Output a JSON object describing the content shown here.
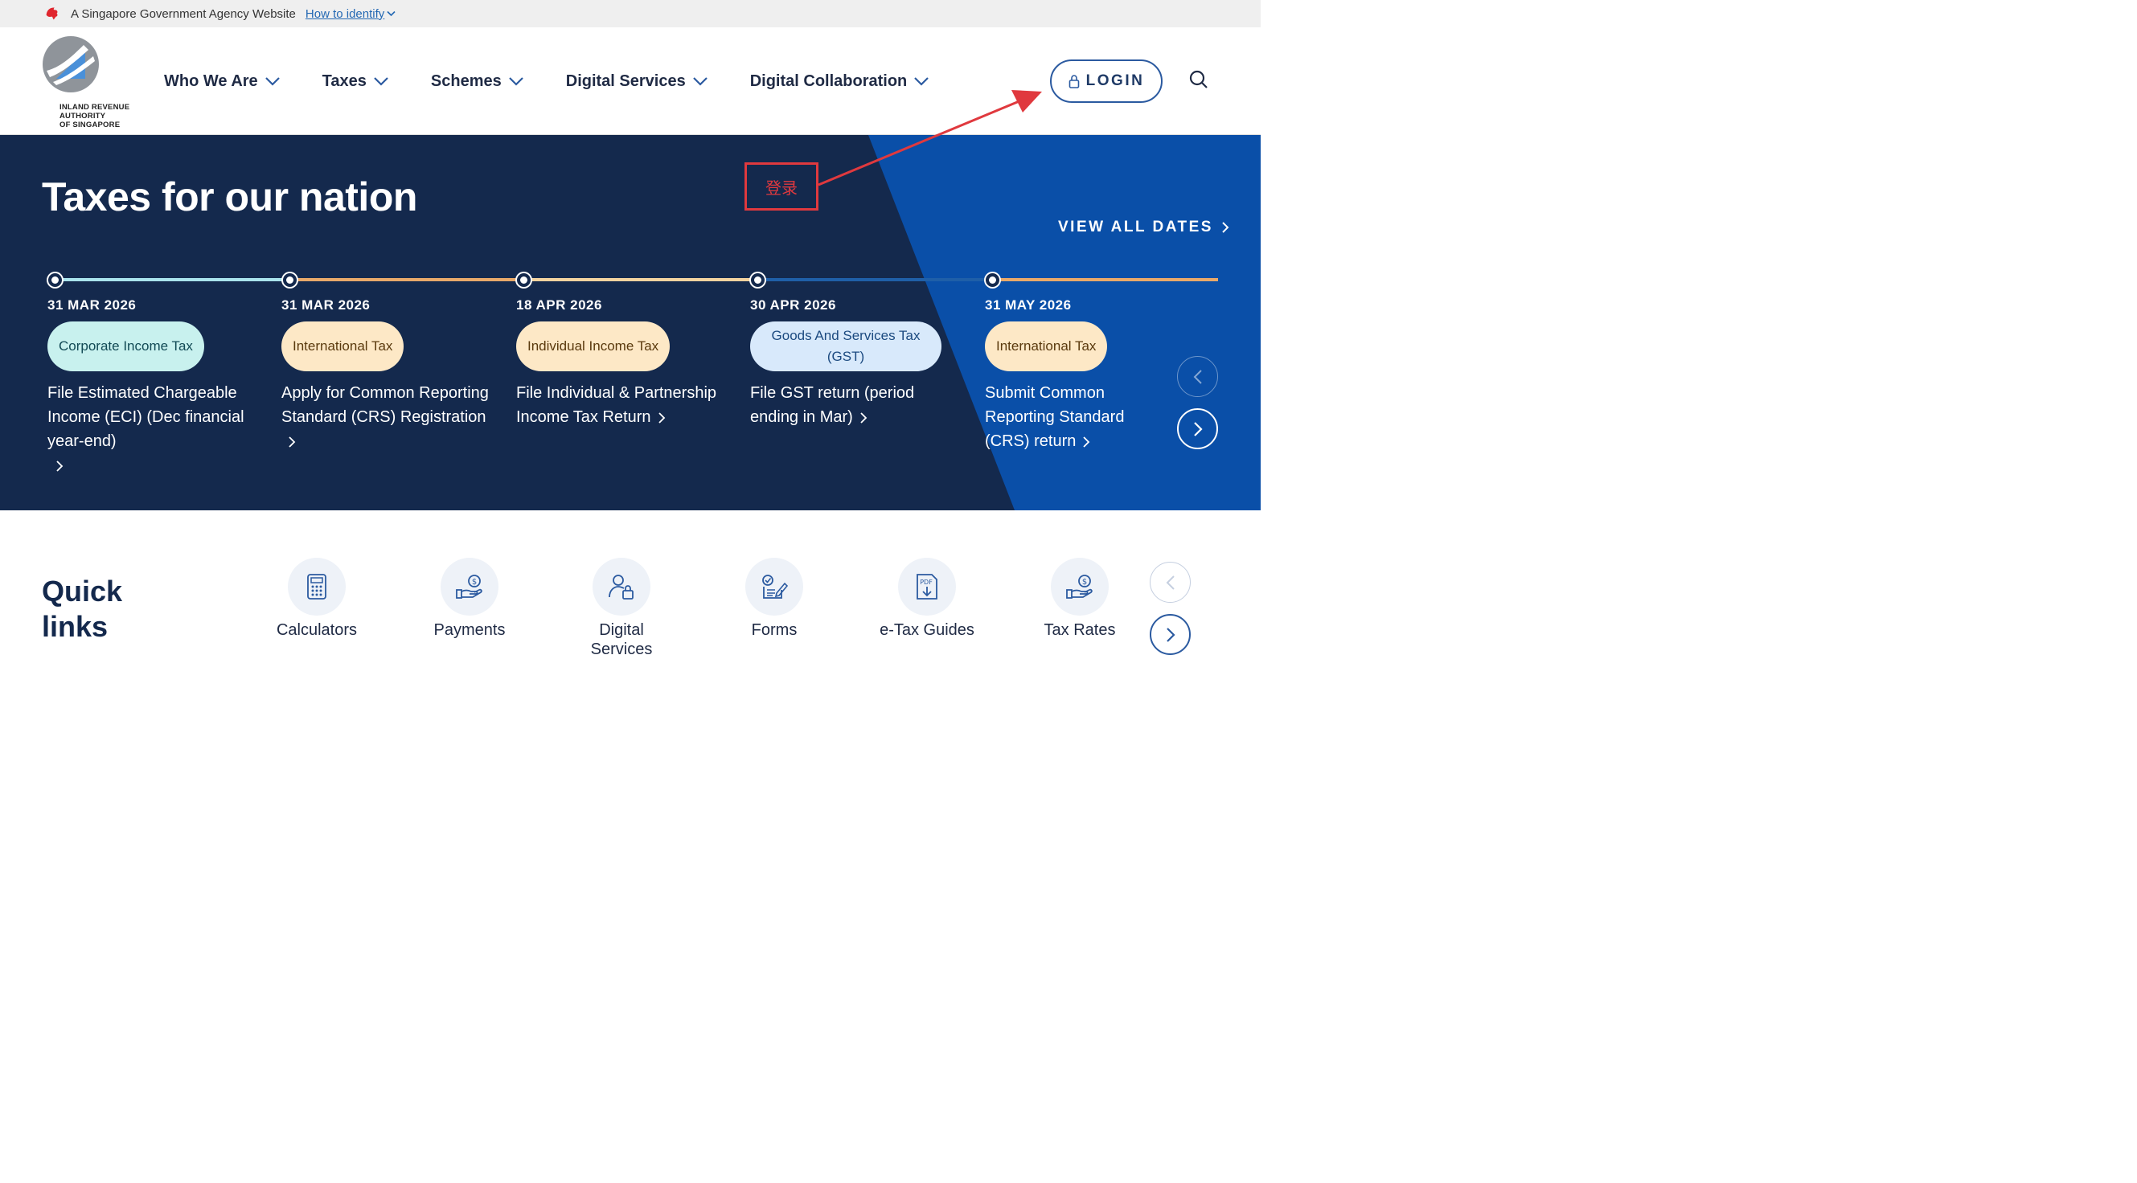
{
  "govbar": {
    "text": "A Singapore Government Agency Website",
    "link": "How to identify"
  },
  "header": {
    "logo_text": [
      "INLAND REVENUE",
      "AUTHORITY",
      "OF SINGAPORE"
    ],
    "nav": [
      {
        "label": "Who We Are"
      },
      {
        "label": "Taxes"
      },
      {
        "label": "Schemes"
      },
      {
        "label": "Digital Services"
      },
      {
        "label": "Digital Collaboration"
      }
    ],
    "login_label": "LOGIN"
  },
  "hero": {
    "title": "Taxes for our nation",
    "view_all": "VIEW ALL DATES",
    "annotation": "登录",
    "events": [
      {
        "date": "31 MAR 2026",
        "category": "Corporate Income Tax",
        "description": "File Estimated Chargeable Income (ECI) (Dec financial year-end)"
      },
      {
        "date": "31 MAR 2026",
        "category": "International Tax",
        "description": "Apply for Common Reporting Standard (CRS) Registration"
      },
      {
        "date": "18 APR 2026",
        "category": "Individual Income Tax",
        "description": "File Individual & Partnership Income Tax Return"
      },
      {
        "date": "30 APR 2026",
        "category": "Goods And Services Tax (GST)",
        "description": "File GST return (period ending in Mar)"
      },
      {
        "date": "31 MAY 2026",
        "category": "International Tax",
        "description": "Submit Common Reporting Standard (CRS) return"
      }
    ]
  },
  "quick_links": {
    "title": "Quick links",
    "items": [
      {
        "label": "Calculators",
        "icon": "calculator-icon"
      },
      {
        "label": "Payments",
        "icon": "payment-hand-icon"
      },
      {
        "label": "Digital Services",
        "icon": "user-lock-icon"
      },
      {
        "label": "Forms",
        "icon": "form-icon"
      },
      {
        "label": "e-Tax Guides",
        "icon": "pdf-download-icon"
      },
      {
        "label": "Tax Rates",
        "icon": "tax-rates-icon"
      }
    ]
  },
  "colors": {
    "navy": "#14294d",
    "blue": "#0a4fa8",
    "accent_red": "#e0393e",
    "teal_line": "#a9e3ec",
    "orange_line": "#e8a96a",
    "blue_line": "#1f5fa8"
  }
}
